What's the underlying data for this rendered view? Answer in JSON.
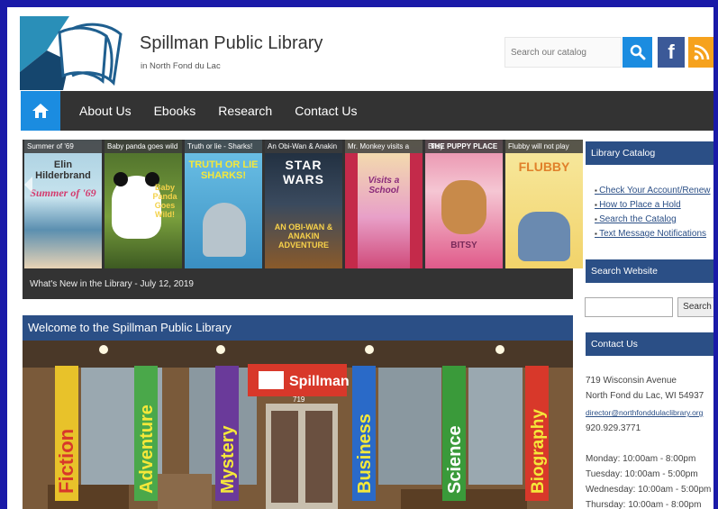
{
  "site": {
    "title": "Spillman Public Library",
    "subtitle": "in North Fond du Lac"
  },
  "search": {
    "placeholder": "Search our catalog"
  },
  "social": {
    "facebook": "f"
  },
  "nav": {
    "items": [
      "About Us",
      "Ebooks",
      "Research",
      "Contact Us"
    ]
  },
  "slider": {
    "books": [
      {
        "caption": "Summer of '69",
        "title": "Summer of '69",
        "author": "Elin Hilderbrand"
      },
      {
        "caption": "Baby panda goes wild",
        "title": "Baby Panda Goes Wild!"
      },
      {
        "caption": "Truth or lie - Sharks!",
        "title": "TRUTH OR LIE SHARKS!"
      },
      {
        "caption": "An Obi-Wan & Anakin",
        "title": "STAR WARS",
        "subtitle": "AN OBI-WAN & ANAKIN ADVENTURE"
      },
      {
        "caption": "Mr. Monkey visits a",
        "title": "Visits a School"
      },
      {
        "caption": "Bitsy",
        "title": "THE PUPPY PLACE",
        "subtitle": "BITSY"
      },
      {
        "caption": "Flubby will not play",
        "title": "FLUBBY"
      }
    ],
    "caption": "What's New in the Library - July 12, 2019"
  },
  "welcome": {
    "title": "Welcome to the Spillman Public Library",
    "banners": [
      "Fiction",
      "Adventure",
      "Mystery",
      "Business",
      "Science",
      "Biography"
    ],
    "sign": "Spillman",
    "sign_number": "719"
  },
  "sidebar": {
    "catalog_title": "Library Catalog",
    "catalog_links": [
      "Check Your Account/Renew",
      "How to Place a Hold",
      "Search the Catalog",
      "Text Message Notifications"
    ],
    "search_title": "Search Website",
    "search_button": "Search",
    "contact_title": "Contact Us",
    "address1": "719 Wisconsin Avenue",
    "address2": "North Fond du Lac, WI 54937",
    "email": "director@northfonddulaclibrary.org",
    "phone": "920.929.3771",
    "hours": [
      "Monday: 10:00am - 8:00pm",
      "Tuesday: 10:00am - 5:00pm",
      "Wednesday: 10:00am - 5:00pm",
      "Thursday: 10:00am - 8:00pm"
    ]
  },
  "colors": {
    "nav_bg": "#333333",
    "accent_blue": "#1b8ce0",
    "section_blue": "#2b4f86",
    "facebook": "#3b5998",
    "rss": "#f6a21d",
    "page_border": "#1a1aa8"
  }
}
